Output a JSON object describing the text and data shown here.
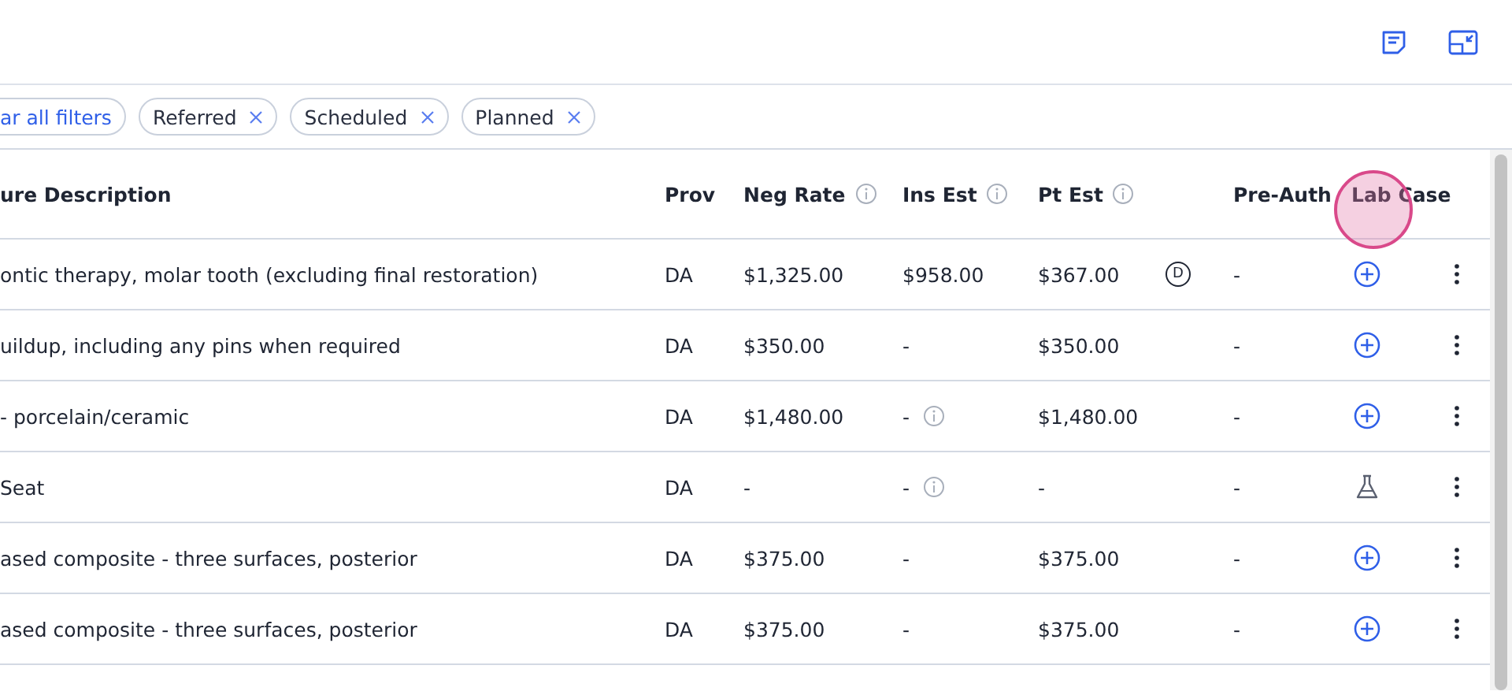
{
  "filters": [
    {
      "label": "ar all filters",
      "kind": "clear"
    },
    {
      "label": "Referred",
      "kind": "chip"
    },
    {
      "label": "Scheduled",
      "kind": "chip"
    },
    {
      "label": "Planned",
      "kind": "chip"
    }
  ],
  "columns": [
    {
      "label": "ure Description",
      "info": false
    },
    {
      "label": "Prov",
      "info": false
    },
    {
      "label": "Neg Rate",
      "info": true
    },
    {
      "label": "Ins Est",
      "info": true
    },
    {
      "label": "Pt Est",
      "info": true
    },
    {
      "label": "Pre-Auth",
      "info": false
    },
    {
      "label": "Lab Case",
      "info": false
    }
  ],
  "rows": [
    {
      "description": "ontic therapy, molar tooth (excluding final restoration)",
      "prov": "DA",
      "neg_rate": "$1,325.00",
      "ins_est": "$958.00",
      "ins_info": false,
      "pt_est": "$367.00",
      "badge": "D",
      "pre_auth": "-",
      "kind": "add"
    },
    {
      "description": "uildup, including any pins when required",
      "prov": "DA",
      "neg_rate": "$350.00",
      "ins_est": "-",
      "ins_info": false,
      "pt_est": "$350.00",
      "pre_auth": "-",
      "kind": "add"
    },
    {
      "description": "- porcelain/ceramic",
      "prov": "DA",
      "neg_rate": "$1,480.00",
      "ins_est": "-",
      "ins_info": true,
      "pt_est": "$1,480.00",
      "pre_auth": "-",
      "kind": "add"
    },
    {
      "description": "Seat",
      "prov": "DA",
      "neg_rate": "-",
      "ins_est": "-",
      "ins_info": true,
      "pt_est": "-",
      "pre_auth": "-",
      "kind": "flask"
    },
    {
      "description": "ased composite - three surfaces, posterior",
      "prov": "DA",
      "neg_rate": "$375.00",
      "ins_est": "-",
      "ins_info": false,
      "pt_est": "$375.00",
      "pre_auth": "-",
      "kind": "add"
    },
    {
      "description": "ased composite - three surfaces, posterior",
      "prov": "DA",
      "neg_rate": "$375.00",
      "ins_est": "-",
      "ins_info": false,
      "pt_est": "$375.00",
      "pre_auth": "-",
      "kind": "add"
    }
  ]
}
